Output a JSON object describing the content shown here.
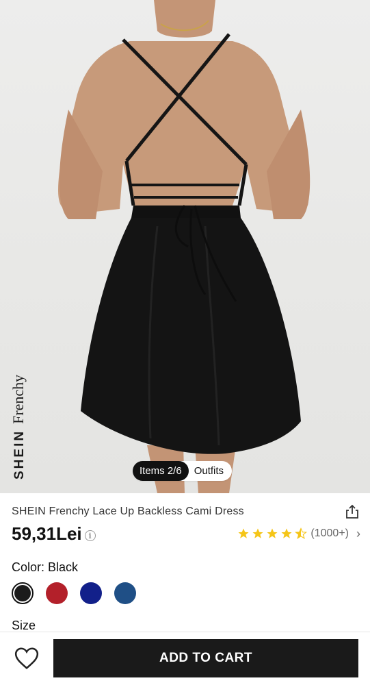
{
  "hero": {
    "brand_text_bold": "SHEIN",
    "brand_text_script": "Frenchy",
    "pill": {
      "items_label": "Items 2/6",
      "outfits_label": "Outfits"
    }
  },
  "product": {
    "title": "SHEIN Frenchy Lace Up Backless Cami Dress",
    "price": "59,31Lei",
    "rating": {
      "stars": 4.5,
      "reviews_label": "(1000+)"
    },
    "color_label": "Color: Black",
    "swatches": [
      {
        "name": "Black",
        "color": "#1b1b1b",
        "selected": true
      },
      {
        "name": "Red",
        "color": "#b3202a"
      },
      {
        "name": "Navy",
        "color": "#12208a"
      },
      {
        "name": "Blue",
        "color": "#1f4f86"
      }
    ],
    "size_label": "Size"
  },
  "bottom_bar": {
    "add_to_cart_label": "ADD TO CART"
  },
  "colors": {
    "star": "#f5c518",
    "cta_bg": "#1a1a1a"
  }
}
